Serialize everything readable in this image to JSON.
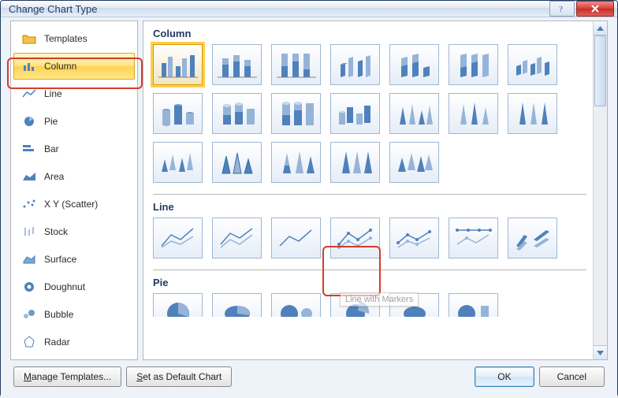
{
  "window": {
    "title": "Change Chart Type"
  },
  "sidebar": {
    "items": [
      {
        "label": "Templates",
        "icon": "folder-icon"
      },
      {
        "label": "Column",
        "icon": "column-icon",
        "selected": true
      },
      {
        "label": "Line",
        "icon": "line-icon"
      },
      {
        "label": "Pie",
        "icon": "pie-icon"
      },
      {
        "label": "Bar",
        "icon": "bar-icon"
      },
      {
        "label": "Area",
        "icon": "area-icon"
      },
      {
        "label": "X Y (Scatter)",
        "icon": "scatter-icon"
      },
      {
        "label": "Stock",
        "icon": "stock-icon"
      },
      {
        "label": "Surface",
        "icon": "surface-icon"
      },
      {
        "label": "Doughnut",
        "icon": "doughnut-icon"
      },
      {
        "label": "Bubble",
        "icon": "bubble-icon"
      },
      {
        "label": "Radar",
        "icon": "radar-icon"
      }
    ]
  },
  "gallery": {
    "sections": [
      {
        "heading": "Column",
        "thumbs": 19,
        "selected_index": 0
      },
      {
        "heading": "Line",
        "thumbs": 7,
        "highlighted_index": 3,
        "tooltip": "Line with Markers"
      },
      {
        "heading": "Pie",
        "thumbs": 6
      }
    ]
  },
  "buttons": {
    "manage_templates": "Manage Templates...",
    "set_default": "Set as Default Chart",
    "ok": "OK",
    "cancel": "Cancel"
  }
}
